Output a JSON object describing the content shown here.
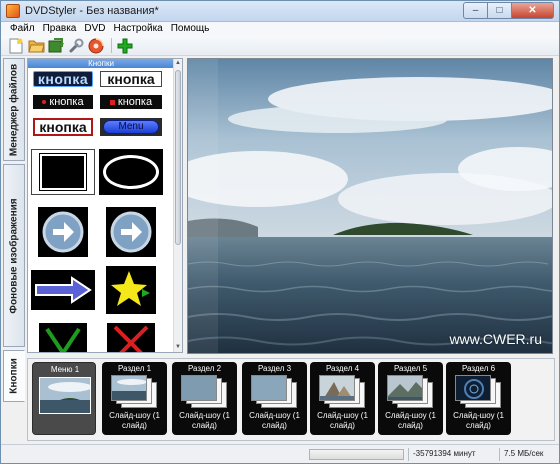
{
  "window": {
    "title": "DVDStyler - Без названия*",
    "minimize_glyph": "–",
    "maximize_glyph": "□",
    "close_glyph": "✕"
  },
  "menubar": {
    "items": [
      "Файл",
      "Правка",
      "DVD",
      "Настройка",
      "Помощь"
    ]
  },
  "toolbar": {
    "icons": [
      "new-file-icon",
      "open-folder-icon",
      "save-icon",
      "settings-wrench-icon",
      "burn-disc-icon",
      "add-icon"
    ]
  },
  "tabs": {
    "file_manager": "Менеджер файлов",
    "backgrounds": "Фоновые изображения",
    "buttons": "Кнопки"
  },
  "panel": {
    "header": "Кнопки",
    "text_buttons": [
      "кнопка",
      "кнопка",
      "кнопка",
      "кнопка",
      "кнопка",
      "кнопка"
    ],
    "menu_button": "Menu"
  },
  "preview": {
    "watermark": "www.CWER.ru"
  },
  "titleset": {
    "menu_label": "Меню 1",
    "sections": [
      {
        "label": "Раздел 1",
        "subtitle": "Слайд-шоу (1 слайд)"
      },
      {
        "label": "Раздел 2",
        "subtitle": "Слайд-шоу (1 слайд)"
      },
      {
        "label": "Раздел 3",
        "subtitle": "Слайд-шоу (1 слайд)"
      },
      {
        "label": "Раздел 4",
        "subtitle": "Слайд-шоу (1 слайд)"
      },
      {
        "label": "Раздел 5",
        "subtitle": "Слайд-шоу (1 слайд)"
      },
      {
        "label": "Раздел 6",
        "subtitle": "Слайд-шоу (1 слайд)"
      }
    ]
  },
  "statusbar": {
    "time": "-35791394 минут",
    "speed": "7.5 МБ/сек"
  },
  "colors": {
    "selection_blue": "#4a86d6",
    "add_green": "#1faa1f",
    "menu_button_blue": "#1c3fd6"
  }
}
